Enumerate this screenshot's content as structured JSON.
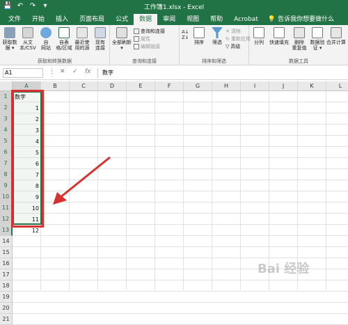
{
  "window": {
    "title": "工作簿1.xlsx  -  Excel"
  },
  "qat": {
    "save": "💾",
    "undo": "↶",
    "redo": "↷",
    "more": "▾"
  },
  "tabs": [
    {
      "label": "文件"
    },
    {
      "label": "开始"
    },
    {
      "label": "插入"
    },
    {
      "label": "页面布局"
    },
    {
      "label": "公式"
    },
    {
      "label": "数据"
    },
    {
      "label": "审阅"
    },
    {
      "label": "视图"
    },
    {
      "label": "帮助"
    },
    {
      "label": "Acrobat"
    }
  ],
  "tellme": "告诉我你想要做什么",
  "ribbon": {
    "get_data": {
      "label1": "获取数",
      "label2": "据 ▾"
    },
    "from_csv": {
      "label1": "从文",
      "label2": "本/CSV"
    },
    "from_web": {
      "label1": "自",
      "label2": "网站"
    },
    "from_table": {
      "label1": "自表",
      "label2": "格/区域"
    },
    "recent": {
      "label1": "最近使",
      "label2": "用的源"
    },
    "existing": {
      "label1": "现有",
      "label2": "连接"
    },
    "group1_label": "获取和转换数据",
    "refresh_all": {
      "label1": "全部刷新",
      "label2": "▾"
    },
    "queries": "查询和连接",
    "properties": "属性",
    "edit_links": "编辑链接",
    "group2_label": "查询和连接",
    "sort": "排序",
    "filter": "筛选",
    "clear": "清除",
    "reapply": "重新应用",
    "advanced": "高级",
    "group3_label": "排序和筛选",
    "split": "分列",
    "flash_fill": "快速填充",
    "remove_dup": {
      "label1": "删除",
      "label2": "重复值"
    },
    "validation": {
      "label1": "数据验",
      "label2": "证 ▾"
    },
    "consolidate": "合并计算",
    "group4_label": "数据工具"
  },
  "formula_bar": {
    "name_box": "A1",
    "cancel": "✕",
    "enter": "✓",
    "fx": "fx",
    "content": "数字"
  },
  "columns": [
    "A",
    "B",
    "C",
    "D",
    "E",
    "F",
    "G",
    "H",
    "I",
    "J",
    "K",
    "L"
  ],
  "rows": [
    "1",
    "2",
    "3",
    "4",
    "5",
    "6",
    "7",
    "8",
    "9",
    "10",
    "11",
    "12",
    "13",
    "14",
    "15",
    "16",
    "17",
    "18",
    "19",
    "20",
    "21"
  ],
  "cells": {
    "A1": "数字",
    "A_values": [
      "1",
      "2",
      "3",
      "4",
      "5",
      "6",
      "7",
      "8",
      "9",
      "10",
      "11",
      "12"
    ]
  },
  "watermark": "Bai 经验",
  "colors": {
    "excel_green": "#217346",
    "annotation_red": "#d93030"
  }
}
